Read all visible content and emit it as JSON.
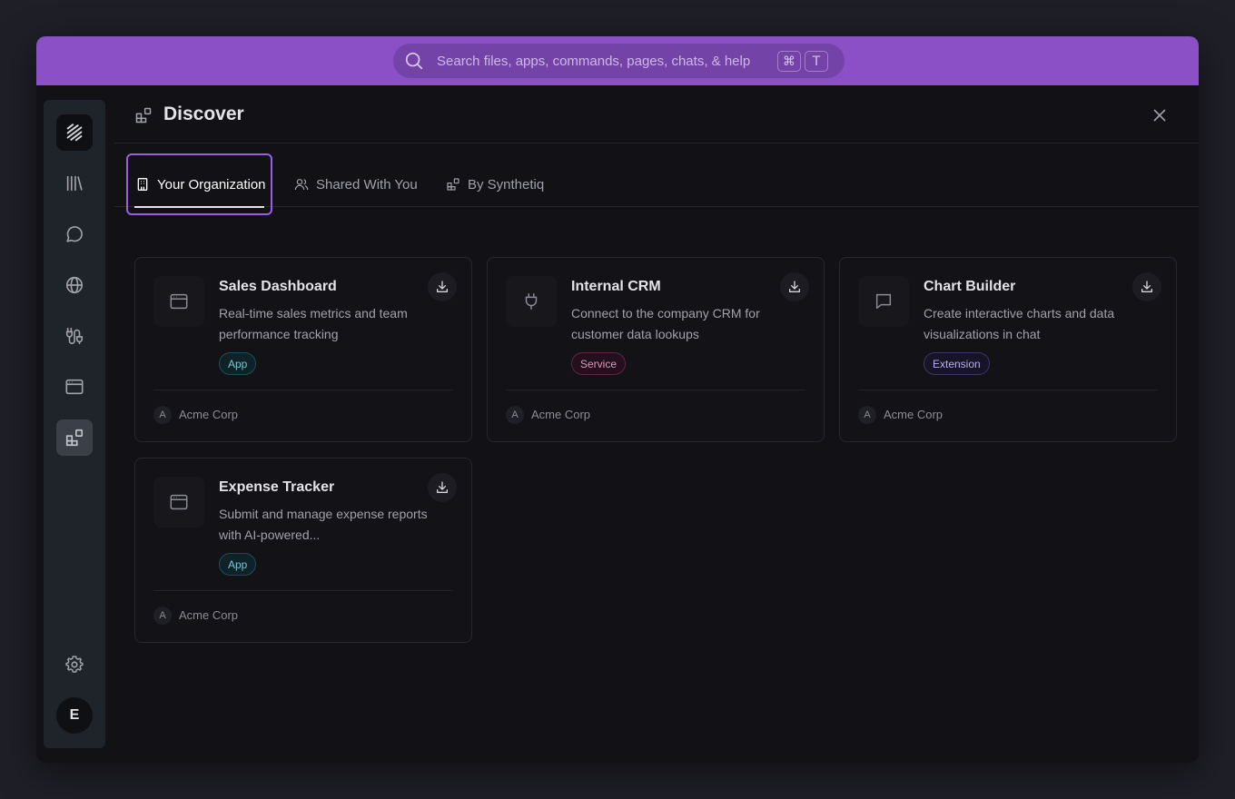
{
  "search": {
    "placeholder": "Search files, apps, commands, pages, chats, & help",
    "shortcut_keys": [
      "⌘",
      "T"
    ]
  },
  "sidebar": {
    "items": [
      {
        "name": "logo",
        "icon": "stack-logo-icon"
      },
      {
        "name": "library",
        "icon": "library-icon"
      },
      {
        "name": "chats",
        "icon": "chat-bubble-icon"
      },
      {
        "name": "web",
        "icon": "globe-icon"
      },
      {
        "name": "integrations",
        "icon": "plug-route-icon"
      },
      {
        "name": "apps",
        "icon": "app-window-icon"
      },
      {
        "name": "discover",
        "icon": "blocks-icon",
        "active": true
      },
      {
        "name": "settings",
        "icon": "gear-icon"
      }
    ],
    "avatar_initial": "E"
  },
  "header": {
    "title": "Discover"
  },
  "tabs": [
    {
      "label": "Your Organization",
      "icon": "building-icon",
      "active": true
    },
    {
      "label": "Shared With You",
      "icon": "users-icon",
      "active": false
    },
    {
      "label": "By Synthetiq",
      "icon": "blocks-icon",
      "active": false
    }
  ],
  "cards": [
    {
      "title": "Sales Dashboard",
      "description": "Real-time sales metrics and team performance tracking",
      "badge": "App",
      "badge_type": "app",
      "icon": "app-window-icon",
      "org_initial": "A",
      "org": "Acme Corp"
    },
    {
      "title": "Internal CRM",
      "description": "Connect to the company CRM for customer data lookups",
      "badge": "Service",
      "badge_type": "service",
      "icon": "plug-icon",
      "org_initial": "A",
      "org": "Acme Corp"
    },
    {
      "title": "Chart Builder",
      "description": "Create interactive charts and data visualizations in chat",
      "badge": "Extension",
      "badge_type": "extension",
      "icon": "message-square-icon",
      "org_initial": "A",
      "org": "Acme Corp"
    },
    {
      "title": "Expense Tracker",
      "description": "Submit and manage expense reports with AI-powered...",
      "badge": "App",
      "badge_type": "app",
      "icon": "app-window-icon",
      "org_initial": "A",
      "org": "Acme Corp"
    }
  ],
  "colors": {
    "accent": "#8b4fc6",
    "tab_focus": "#9b5de5",
    "background": "#111116"
  }
}
